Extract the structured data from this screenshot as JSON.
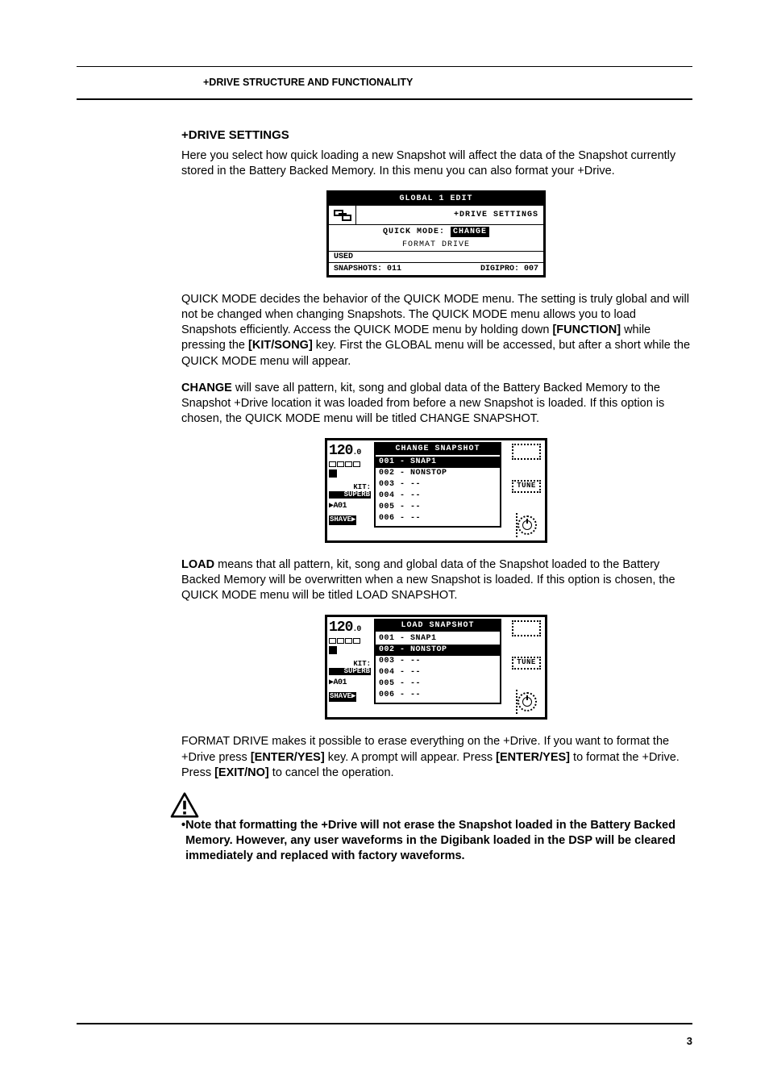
{
  "running_head": "+DRIVE STRUCTURE AND FUNCTIONALITY",
  "page_number": "3",
  "h2": "+DRIVE SETTINGS",
  "p1": "Here you select how quick loading a new Snapshot will affect the data of the Snapshot currently stored in the Battery Backed Memory. In this menu you can also format your +Drive.",
  "lcd1": {
    "title": "GLOBAL 1 EDIT",
    "subtitle": "+DRIVE SETTINGS",
    "quick_mode_label": "QUICK MODE:",
    "quick_mode_value": "CHANGE",
    "format_drive": "FORMAT DRIVE",
    "used": "USED",
    "snapshots_label": "SNAPSHOTS:",
    "snapshots_value": "011",
    "digipro_label": "DIGIPRO:",
    "digipro_value": "007"
  },
  "p2_a": "QUICK MODE decides the behavior of the QUICK MODE menu. The setting is truly global and will not be changed when changing Snapshots. The QUICK MODE menu allows you to load Snapshots efficiently. Access the QUICK MODE menu by holding down ",
  "p2_b": "[FUNCTION]",
  "p2_c": " while pressing the ",
  "p2_d": "[KIT/SONG]",
  "p2_e": " key. First the GLOBAL menu will be accessed, but after a short while the QUICK MODE menu will appear.",
  "p3_a": "CHANGE",
  "p3_b": " will save all pattern, kit, song and global data of the Battery Backed Memory to the Snapshot +Drive location it was loaded from before a new Snapshot is loaded. If this option is chosen, the QUICK MODE menu will be titled CHANGE SNAPSHOT.",
  "lcd2a": {
    "bpm": "120",
    "bpm_dec": ".0",
    "kit_label": "KIT:",
    "kit_name": "SUPERB",
    "pattern": "▶A01",
    "shave": "SHAVE▶",
    "menu_title": "CHANGE SNAPSHOT",
    "items": [
      "001 - SNAP1",
      "002 - NONSTOP",
      "003 - --",
      "004 - --",
      "005 - --",
      "006 - --"
    ],
    "selected": 0,
    "tune": "TUNE"
  },
  "p4_a": "LOAD",
  "p4_b": " means that all pattern, kit, song and global data of the Snapshot loaded to the Battery Backed Memory will be overwritten when a new Snapshot is loaded. If this option is chosen, the QUICK MODE menu will be titled LOAD SNAPSHOT.",
  "lcd2b": {
    "bpm": "120",
    "bpm_dec": ".0",
    "kit_label": "KIT:",
    "kit_name": "SUPERB",
    "pattern": "▶A01",
    "shave": "SHAVE▶",
    "menu_title": "LOAD SNAPSHOT",
    "items": [
      "001 - SNAP1",
      "002 - NONSTOP",
      "003 - --",
      "004 - --",
      "005 - --",
      "006 - --"
    ],
    "selected": 1,
    "tune": "TUNE"
  },
  "p5_a": "FORMAT DRIVE makes it possible to erase everything on the +Drive. If you want to format the +Drive press ",
  "p5_b": "[ENTER/YES]",
  "p5_c": " key. A prompt will appear. Press ",
  "p5_d": "[ENTER/YES]",
  "p5_e": " to format the +Drive. Press ",
  "p5_f": "[EXIT/NO]",
  "p5_g": " to cancel the operation.",
  "note_bullet": "•",
  "note_text": "Note that formatting the +Drive will not erase the Snapshot loaded in the Battery Backed Memory. However, any user waveforms in the Digibank loaded in the DSP will be cleared immediately and replaced with factory waveforms."
}
